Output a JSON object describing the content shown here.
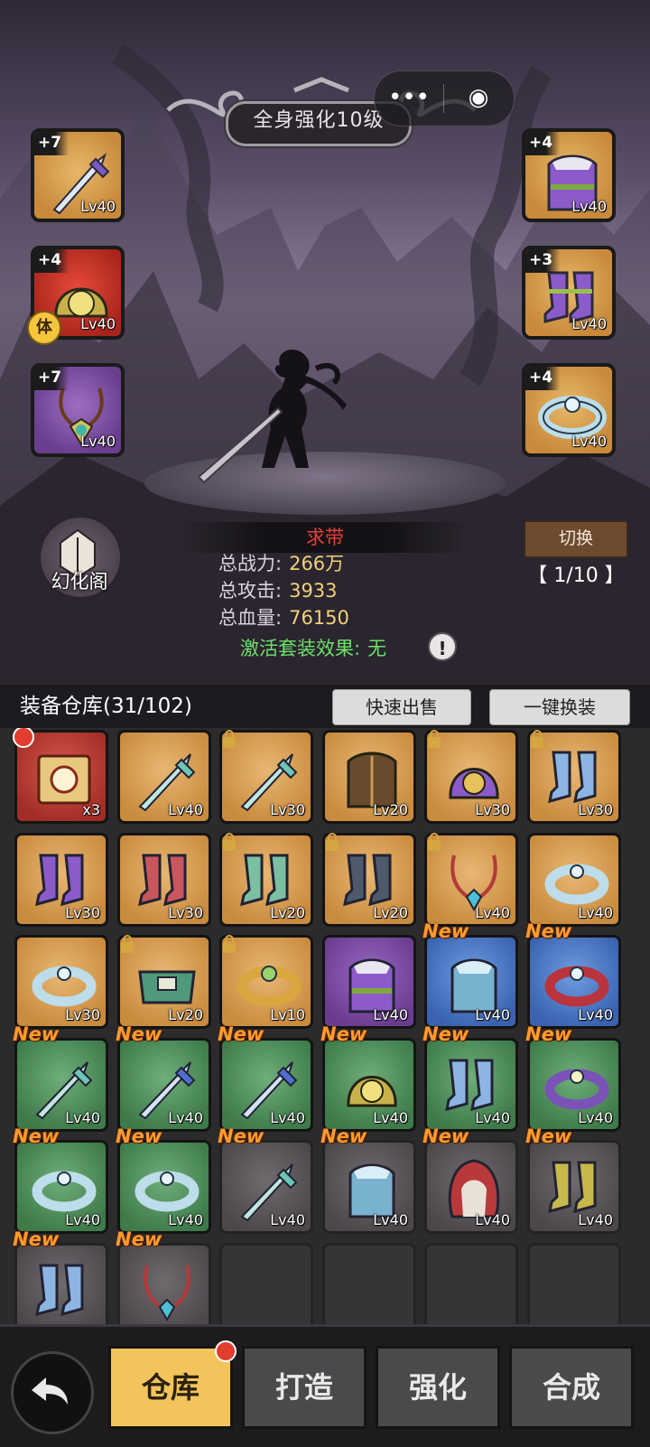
{
  "header": {
    "title": "全身强化10级"
  },
  "capsule": {
    "more_glyph": "•••",
    "close_glyph": "◉"
  },
  "equipped_left": [
    {
      "plus": "+7",
      "level": "Lv40",
      "item": "sword",
      "rarity": "orange"
    },
    {
      "plus": "+4",
      "level": "Lv40",
      "item": "helmet",
      "rarity": "red",
      "badge": "体"
    },
    {
      "plus": "+7",
      "level": "Lv40",
      "item": "necklace",
      "rarity": "purple"
    }
  ],
  "equipped_right": [
    {
      "plus": "+4",
      "level": "Lv40",
      "item": "armor",
      "rarity": "orange"
    },
    {
      "plus": "+3",
      "level": "Lv40",
      "item": "boots",
      "rarity": "orange"
    },
    {
      "plus": "+4",
      "level": "Lv40",
      "item": "ring",
      "rarity": "orange"
    }
  ],
  "huanhua": {
    "label": "幻化阁"
  },
  "character": {
    "name": "求带",
    "power_label": "总战力:",
    "power_value": "266万",
    "attack_label": "总攻击:",
    "attack_value": "3933",
    "hp_label": "总血量:",
    "hp_value": "76150",
    "set_label": "激活套装效果:",
    "set_value": "无"
  },
  "switcher": {
    "button": "切换",
    "page": "【 1/10 】"
  },
  "inventory": {
    "title": "装备仓库(31/102)",
    "quick_sell": "快速出售",
    "one_click_equip": "一键换装",
    "new_tag": "New",
    "rows": [
      [
        {
          "item": "chest",
          "rarity": "red",
          "level": "x3",
          "dot": true
        },
        {
          "item": "sword",
          "rarity": "orange",
          "level": "Lv40"
        },
        {
          "item": "sword",
          "rarity": "orange",
          "level": "Lv30",
          "lock": true
        },
        {
          "item": "armor-brown",
          "rarity": "orange",
          "level": "Lv20"
        },
        {
          "item": "helmet-purple",
          "rarity": "orange",
          "level": "Lv30",
          "lock": true
        },
        {
          "item": "boots-blue",
          "rarity": "orange",
          "level": "Lv30",
          "lock": true
        }
      ],
      [
        {
          "item": "boots-purple",
          "rarity": "orange",
          "level": "Lv30"
        },
        {
          "item": "boots-red",
          "rarity": "orange",
          "level": "Lv30"
        },
        {
          "item": "boots-green",
          "rarity": "orange",
          "level": "Lv20",
          "lock": true
        },
        {
          "item": "boots-dark",
          "rarity": "orange",
          "level": "Lv20",
          "lock": true
        },
        {
          "item": "necklace",
          "rarity": "orange",
          "level": "Lv40",
          "lock": true
        },
        {
          "item": "ring",
          "rarity": "orange",
          "level": "Lv40"
        }
      ],
      [
        {
          "item": "ring",
          "rarity": "orange",
          "level": "Lv30"
        },
        {
          "item": "belt",
          "rarity": "orange",
          "level": "Lv20",
          "lock": true
        },
        {
          "item": "ring-gold",
          "rarity": "orange",
          "level": "Lv10",
          "lock": true
        },
        {
          "item": "armor",
          "rarity": "purple",
          "level": "Lv40"
        },
        {
          "item": "armor-blue",
          "rarity": "blue",
          "level": "Lv40",
          "new": true
        },
        {
          "item": "ring-red",
          "rarity": "blue",
          "level": "Lv40",
          "new": true
        }
      ],
      [
        {
          "item": "sword",
          "rarity": "green",
          "level": "Lv40",
          "new": true
        },
        {
          "item": "sword-blue",
          "rarity": "green",
          "level": "Lv40",
          "new": true
        },
        {
          "item": "sword-blue",
          "rarity": "green",
          "level": "Lv40",
          "new": true
        },
        {
          "item": "helmet",
          "rarity": "green",
          "level": "Lv40",
          "new": true
        },
        {
          "item": "boots-blue",
          "rarity": "green",
          "level": "Lv40",
          "new": true
        },
        {
          "item": "ring-purple",
          "rarity": "green",
          "level": "Lv40",
          "new": true
        }
      ],
      [
        {
          "item": "ring",
          "rarity": "green",
          "level": "Lv40",
          "new": true
        },
        {
          "item": "ring",
          "rarity": "green",
          "level": "Lv40",
          "new": true
        },
        {
          "item": "sword",
          "rarity": "gray",
          "level": "Lv40",
          "new": true
        },
        {
          "item": "armor-blue",
          "rarity": "gray",
          "level": "Lv40",
          "new": true
        },
        {
          "item": "hood-red",
          "rarity": "gray",
          "level": "Lv40",
          "new": true
        },
        {
          "item": "boots-yellow",
          "rarity": "gray",
          "level": "Lv40",
          "new": true
        }
      ],
      [
        {
          "item": "boots-blue",
          "rarity": "gray",
          "level": "",
          "new": true
        },
        {
          "item": "necklace",
          "rarity": "gray",
          "level": "",
          "new": true
        },
        {
          "item": "",
          "rarity": "empty",
          "level": ""
        },
        {
          "item": "",
          "rarity": "empty",
          "level": ""
        },
        {
          "item": "",
          "rarity": "empty",
          "level": ""
        },
        {
          "item": "",
          "rarity": "empty",
          "level": ""
        }
      ]
    ]
  },
  "nav": {
    "tabs": [
      "仓库",
      "打造",
      "强化",
      "合成"
    ],
    "active": "仓库"
  },
  "colors": {
    "stat_value": "#f2d27a",
    "set_effect": "#6ee06a",
    "name": "#e5413a",
    "active_tab": "#f2c45b",
    "new_tag": "#ff9a2e"
  }
}
